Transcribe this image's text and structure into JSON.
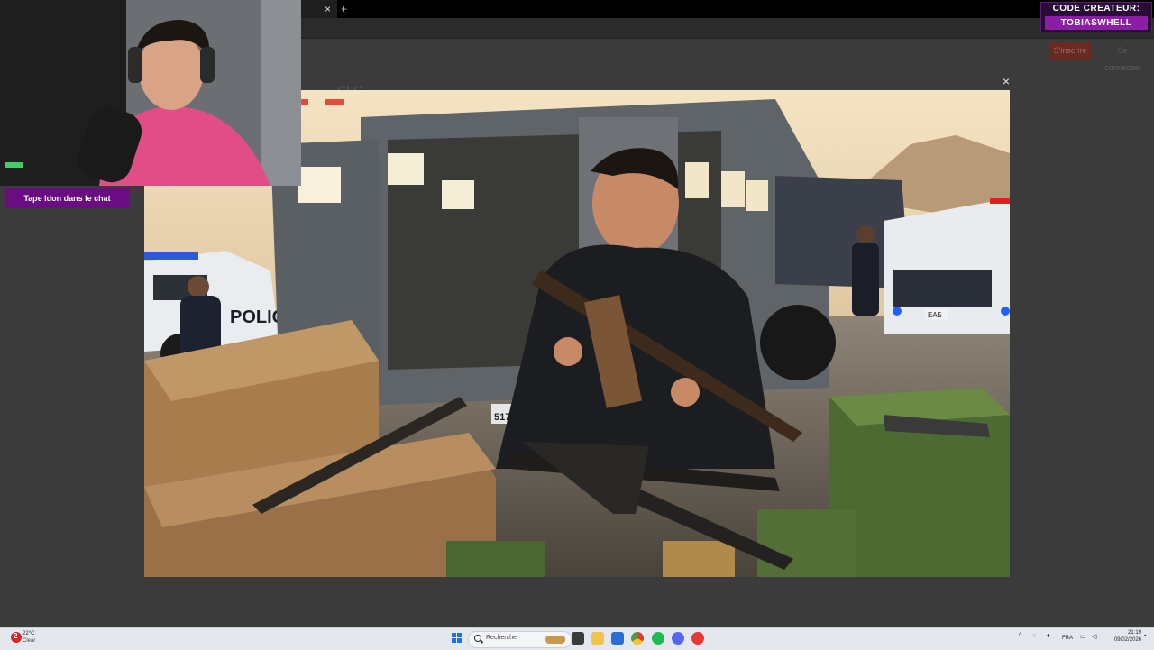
{
  "browser": {
    "tab_close_glyph": "×",
    "new_tab_glyph": "+"
  },
  "site": {
    "subscribe_label": "S'inscrire",
    "login_label": "Se connecter",
    "ghost_title": "Cl C"
  },
  "lightbox": {
    "close_glyph": "×",
    "image_alt": "Thumbnail showing a young man holding an assault rifle in front of an armored police truck with weapon crates",
    "image_text": {
      "police_label": "POLICE",
      "plate_left": "517",
      "plate_right": "ЕАБ"
    }
  },
  "overlay": {
    "creator_code_label": "CODE CREATEUR:",
    "creator_code_value": "TOBIASWHELL",
    "chat_banner": "Tape Idon dans le chat"
  },
  "taskbar": {
    "weather_temp": "22°C",
    "weather_condition": "Clear",
    "weather_badge": "2",
    "search_placeholder": "Rechercher",
    "language": "FRA",
    "time": "21:19",
    "date": "09/02/2026",
    "apps": [
      "widgets",
      "file-explorer",
      "store",
      "chrome",
      "spotify",
      "discord",
      "game"
    ]
  },
  "colors": {
    "banner_purple": "#6a0c82",
    "code_purple": "#8a1fa6",
    "subscribe_red": "#6a2a22",
    "taskbar_bg": "#e4e8ee"
  }
}
